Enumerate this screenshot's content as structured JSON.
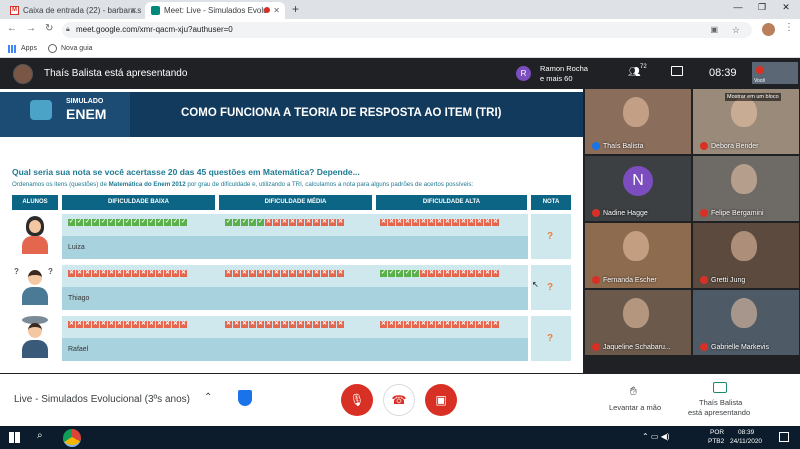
{
  "browser": {
    "tabs": [
      {
        "label": "Caixa de entrada (22) - barbara.s",
        "icon": "gmail-icon"
      },
      {
        "label": "Meet: Live - Simulados Evolu",
        "icon": "meet-icon",
        "active": true
      }
    ],
    "new_tab": "+",
    "url": "meet.google.com/xmr-qacm-xju?authuser=0",
    "bookmarks": [
      {
        "label": "Apps",
        "icon": "apps-grid-icon"
      },
      {
        "label": "Nova guia",
        "icon": "globe-icon"
      }
    ]
  },
  "meet": {
    "presenter_banner": "Thaís Balista está apresentando",
    "participants_badge": {
      "avatar_letter": "R",
      "line1": "Ramon Rocha",
      "line2": "e mais 60"
    },
    "people_count": "72",
    "time": "08:39",
    "you_label": "Você",
    "meeting_name": "Live - Simulados Evolucional (3ºs anos)",
    "raise_hand": "Levantar a mão",
    "presenting": {
      "line1": "Thaís Balista",
      "line2": "está apresentando"
    },
    "show_in_block": "Mostrar em um bloco"
  },
  "slide": {
    "logo_top": "SIMULADO",
    "logo_bottom": "ENEM",
    "title": "COMO FUNCIONA A TEORIA DE RESPOSTA AO ITEM (TRI)",
    "question": "Qual seria sua nota se você acertasse 20 das 45 questões em Matemática? Depende...",
    "subtitle_pre": "Ordenamos os itens (questões) de ",
    "subtitle_bold": "Matemática do Enem 2012",
    "subtitle_post": " por grau de dificuldade e, utilizando a TRI, calculamos a nota para alguns padrões de acertos possíveis:",
    "headers": {
      "alunos": "ALUNOS",
      "baixa": "DIFICULDADE BAIXA",
      "media": "DIFICULDADE MÉDIA",
      "alta": "DIFICULDADE ALTA",
      "nota": "NOTA"
    },
    "students": [
      {
        "name": "Luiza",
        "nota": "?"
      },
      {
        "name": "Thiago",
        "nota": "?"
      },
      {
        "name": "Rafael",
        "nota": "?"
      }
    ]
  },
  "participants": [
    {
      "name": "Thaís Balista",
      "muted": false,
      "bg": "#8a6d5a"
    },
    {
      "name": "Debora Bender",
      "muted": true,
      "bg": "#9a8a7a"
    },
    {
      "name": "Nadine Hagge",
      "muted": true,
      "bg": "#3c4043",
      "letter": "N"
    },
    {
      "name": "Felipe Bergamini",
      "muted": true,
      "bg": "#6e6a66"
    },
    {
      "name": "Fernanda Escher",
      "muted": true,
      "bg": "#8d6b4e"
    },
    {
      "name": "Gretti Jung",
      "muted": true,
      "bg": "#5c4a3e"
    },
    {
      "name": "Jaqueline Schabaru...",
      "muted": true,
      "bg": "#6b5a4c"
    },
    {
      "name": "Gabrielle Markevis",
      "muted": true,
      "bg": "#4e5a66"
    }
  ],
  "taskbar": {
    "lang1": "POR",
    "lang2": "PTB2",
    "time": "08:39",
    "date": "24/11/2020"
  }
}
